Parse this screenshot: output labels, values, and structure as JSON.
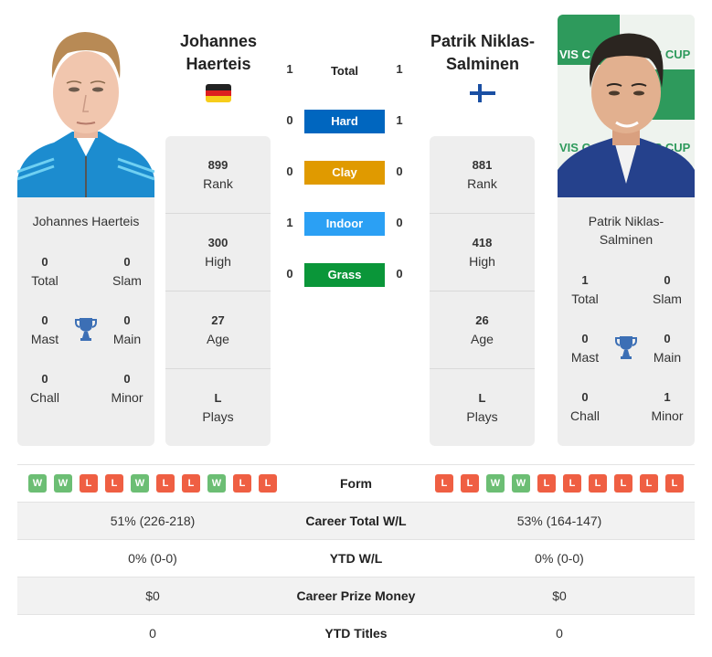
{
  "colors": {
    "hard": "#0066bf",
    "clay": "#e09a00",
    "indoor": "#2ba0f4",
    "grass": "#0a9639",
    "win": "#6cbe74",
    "loss": "#ef5f43",
    "trophy": "#3c6fb5",
    "panel_bg": "#eeeeee"
  },
  "player1": {
    "name": "Johannes Haerteis",
    "header_name_line1": "Johannes",
    "header_name_line2": "Haerteis",
    "flag": "germany-flag",
    "photo": "player-photo",
    "rank": "899",
    "rank_label": "Rank",
    "high": "300",
    "high_label": "High",
    "age": "27",
    "age_label": "Age",
    "plays": "L",
    "plays_label": "Plays",
    "titles": {
      "total": "0",
      "total_label": "Total",
      "slam": "0",
      "slam_label": "Slam",
      "mast": "0",
      "mast_label": "Mast",
      "main": "0",
      "main_label": "Main",
      "chall": "0",
      "chall_label": "Chall",
      "minor": "0",
      "minor_label": "Minor"
    },
    "form": [
      "W",
      "W",
      "L",
      "L",
      "W",
      "L",
      "L",
      "W",
      "L",
      "L"
    ],
    "career_wl": "51% (226-218)",
    "ytd_wl": "0% (0-0)",
    "prize_money": "$0",
    "ytd_titles": "0"
  },
  "player2": {
    "name_line1": "Patrik Niklas-",
    "name_line2": "Salminen",
    "header_name_line1": "Patrik Niklas-",
    "header_name_line2": "Salminen",
    "flag": "finland-flag",
    "photo": "player-photo",
    "rank": "881",
    "rank_label": "Rank",
    "high": "418",
    "high_label": "High",
    "age": "26",
    "age_label": "Age",
    "plays": "L",
    "plays_label": "Plays",
    "titles": {
      "total": "1",
      "total_label": "Total",
      "slam": "0",
      "slam_label": "Slam",
      "mast": "0",
      "mast_label": "Mast",
      "main": "0",
      "main_label": "Main",
      "chall": "0",
      "chall_label": "Chall",
      "minor": "1",
      "minor_label": "Minor"
    },
    "form": [
      "L",
      "L",
      "W",
      "W",
      "L",
      "L",
      "L",
      "L",
      "L",
      "L"
    ],
    "career_wl": "53% (164-147)",
    "ytd_wl": "0% (0-0)",
    "prize_money": "$0",
    "ytd_titles": "0"
  },
  "h2h": {
    "total": {
      "label": "Total",
      "p1": "1",
      "p2": "1"
    },
    "surfaces": [
      {
        "label": "Hard",
        "p1": "0",
        "p2": "1"
      },
      {
        "label": "Clay",
        "p1": "0",
        "p2": "0"
      },
      {
        "label": "Indoor",
        "p1": "1",
        "p2": "0"
      },
      {
        "label": "Grass",
        "p1": "0",
        "p2": "0"
      }
    ]
  },
  "table": {
    "form_label": "Form",
    "career_wl_label": "Career Total W/L",
    "ytd_wl_label": "YTD W/L",
    "prize_label": "Career Prize Money",
    "ytd_titles_label": "YTD Titles"
  }
}
